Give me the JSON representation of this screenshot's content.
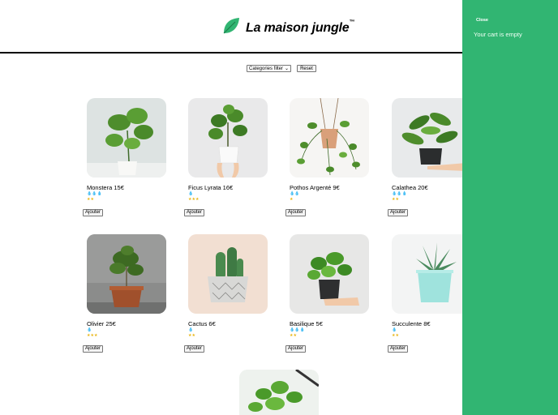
{
  "header": {
    "title": "La maison jungle",
    "trademark": "™"
  },
  "filters": {
    "select_label": "Categories filter",
    "reset_label": "Reset"
  },
  "plants": [
    {
      "name": "Monstera 15€",
      "water": "💧💧💧",
      "light": "★★",
      "add_label": "Ajouter",
      "icon": "monstera-plant-image"
    },
    {
      "name": "Ficus Lyrata 16€",
      "water": "💧",
      "light": "★★★",
      "add_label": "Ajouter",
      "icon": "ficus-lyrata-plant-image"
    },
    {
      "name": "Pothos Argenté 9€",
      "water": "💧💧",
      "light": "★",
      "add_label": "Ajouter",
      "icon": "pothos-plant-image"
    },
    {
      "name": "Calathea 20€",
      "water": "💧💧💧",
      "light": "★★",
      "add_label": "Ajouter",
      "icon": "calathea-plant-image"
    },
    {
      "name": "Olivier 25€",
      "water": "💧",
      "light": "★★★",
      "add_label": "Ajouter",
      "icon": "olive-tree-plant-image"
    },
    {
      "name": "Cactus 6€",
      "water": "💧",
      "light": "★★",
      "add_label": "Ajouter",
      "icon": "cactus-plant-image"
    },
    {
      "name": "Basilique 5€",
      "water": "💧💧💧",
      "light": "★★",
      "add_label": "Ajouter",
      "icon": "basil-plant-image"
    },
    {
      "name": "Succulente 8€",
      "water": "💧",
      "light": "★★",
      "add_label": "Ajouter",
      "icon": "succulent-plant-image"
    }
  ],
  "cart": {
    "close_label": "Close",
    "empty_text": "Your cart is empty"
  },
  "colors": {
    "cart_bg": "#31b572",
    "water": "#3a8fd6",
    "sun": "#e8b512"
  }
}
